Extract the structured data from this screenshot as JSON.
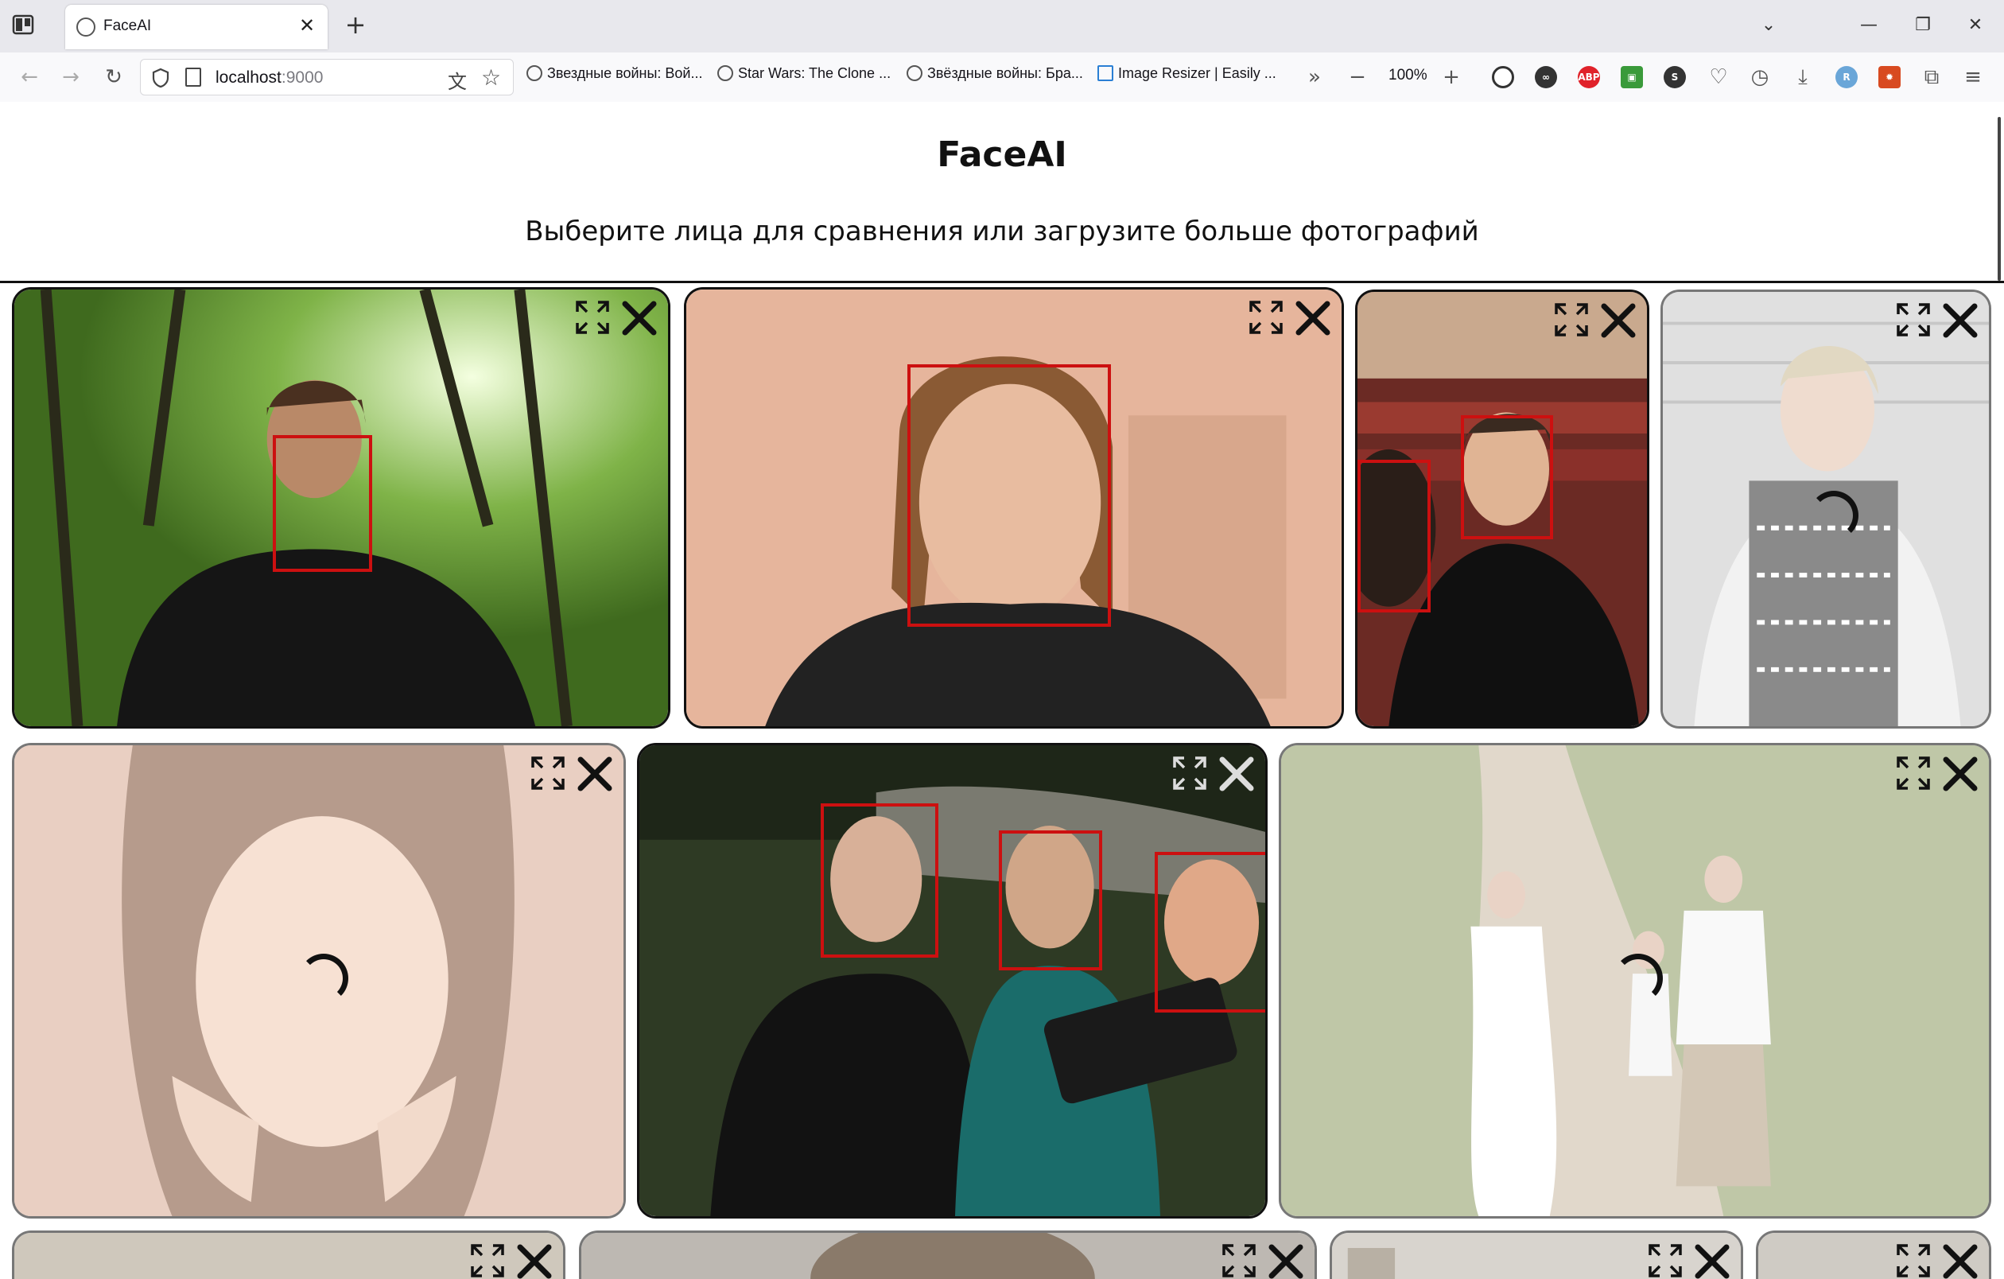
{
  "browser": {
    "tab_title": "FaceAI",
    "url_host": "localhost",
    "url_port": ":9000",
    "zoom": "100%",
    "bookmarks": [
      "Звездные войны: Вой...",
      "Star Wars: The Clone ...",
      "Звёздные войны: Бра...",
      "Image Resizer | Easily ..."
    ],
    "extensions": [
      "ABP",
      "S"
    ]
  },
  "page": {
    "title": "FaceAI",
    "subtitle": "Выберите лица для сравнения или загрузите больше фотографий"
  },
  "icons": {
    "expand": "expand-icon",
    "remove": "close-icon",
    "spinner": "loading-spinner"
  },
  "photos": [
    {
      "state": "processed",
      "faces": 1
    },
    {
      "state": "processed",
      "faces": 1
    },
    {
      "state": "processed",
      "faces": 2
    },
    {
      "state": "loading",
      "faces": 0
    },
    {
      "state": "loading",
      "faces": 0
    },
    {
      "state": "processed",
      "faces": 3
    },
    {
      "state": "loading",
      "faces": 0
    },
    {
      "state": "processed",
      "faces": 0
    },
    {
      "state": "processed",
      "faces": 0
    },
    {
      "state": "processed",
      "faces": 0
    },
    {
      "state": "processed",
      "faces": 0
    }
  ],
  "colors": {
    "face_box": "#cc1010",
    "card_border": "#111111"
  }
}
